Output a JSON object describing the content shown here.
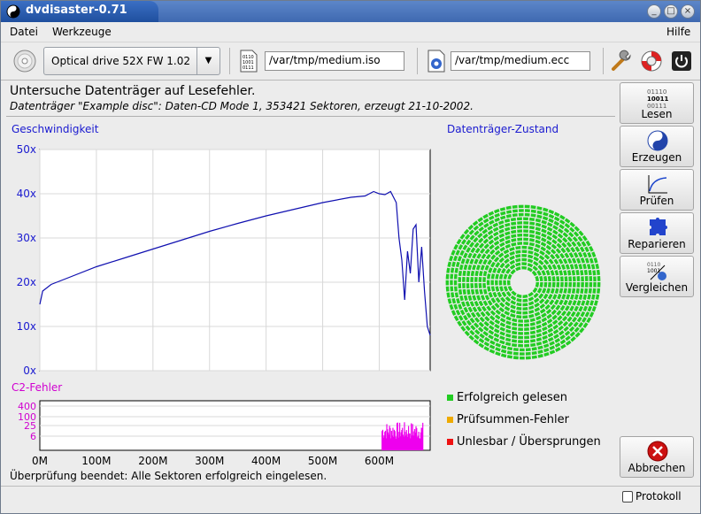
{
  "window": {
    "title": "dvdisaster-0.71",
    "buttons": [
      "_",
      "□",
      "×"
    ]
  },
  "menu": {
    "file": "Datei",
    "tools": "Werkzeuge",
    "help": "Hilfe"
  },
  "toolbar": {
    "drive": "Optical drive 52X FW 1.02",
    "image_path": "/var/tmp/medium.iso",
    "ecc_path": "/var/tmp/medium.ecc"
  },
  "header": {
    "title": "Untersuche Datenträger auf Lesefehler.",
    "info": "Datenträger \"Example disc\": Daten-CD Mode 1, 353421 Sektoren, erzeugt 21-10-2002."
  },
  "sidebar": {
    "read": "Lesen",
    "read_icon_lines": [
      "01110",
      "10011",
      "00111"
    ],
    "create": "Erzeugen",
    "scan": "Prüfen",
    "fix": "Reparieren",
    "compare": "Vergleichen",
    "cancel": "Abbrechen"
  },
  "speed_chart": {
    "title": "Geschwindigkeit",
    "y_ticks": [
      "50x",
      "40x",
      "30x",
      "20x",
      "10x",
      "0x"
    ]
  },
  "c2_chart": {
    "title": "C2-Fehler",
    "y_ticks": [
      "400",
      "100",
      "25",
      "6"
    ],
    "x_ticks": [
      "0M",
      "100M",
      "200M",
      "300M",
      "400M",
      "500M",
      "600M"
    ]
  },
  "disc": {
    "title": "Datenträger-Zustand",
    "legend": [
      {
        "label": "Erfolgreich gelesen",
        "color": "#22cc22"
      },
      {
        "label": "Prüfsummen-Fehler",
        "color": "#eeaa00"
      },
      {
        "label": "Unlesbar / Übersprungen",
        "color": "#ee1111"
      }
    ]
  },
  "status": "Überprüfung beendet: Alle Sektoren erfolgreich eingelesen.",
  "log_button": "Protokoll",
  "chart_data": {
    "type": "line",
    "ylim": [
      0,
      50
    ],
    "xlim_mb": [
      0,
      690
    ],
    "series": [
      {
        "x": [
          0,
          5,
          20,
          50,
          100,
          150,
          200,
          250,
          300,
          350,
          400,
          450,
          500,
          550,
          575,
          590,
          600,
          610,
          620,
          630,
          635,
          640,
          645,
          650,
          655,
          660,
          665,
          670,
          675,
          680,
          685,
          690
        ],
        "values": [
          15,
          18,
          19.5,
          21,
          23.5,
          25.5,
          27.5,
          29.5,
          31.5,
          33.3,
          35,
          36.5,
          38,
          39.2,
          39.5,
          40.5,
          40,
          39.8,
          40.5,
          38,
          30,
          25,
          16,
          27,
          22,
          32,
          33,
          20,
          28,
          18,
          10,
          8
        ]
      }
    ],
    "c2_region_mb": [
      605,
      678
    ],
    "c2_max": 100
  }
}
